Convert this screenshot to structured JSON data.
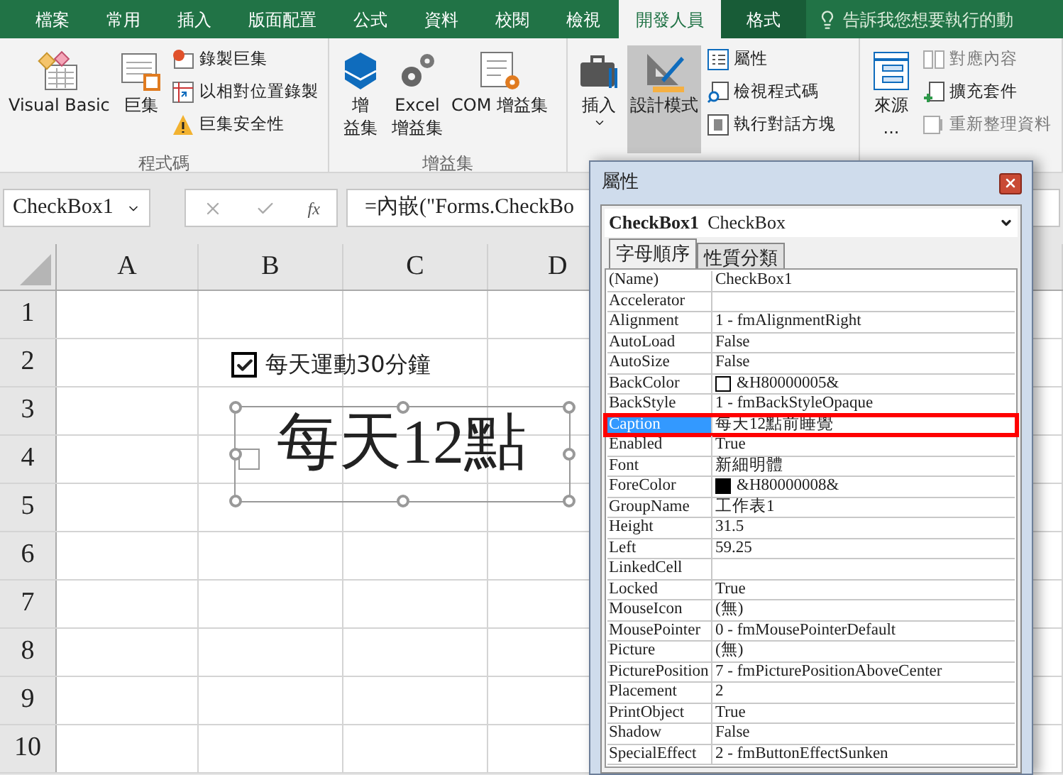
{
  "ribbon_tabs": [
    {
      "label": "檔案",
      "selected": false,
      "kind": "normal"
    },
    {
      "label": "常用",
      "selected": false,
      "kind": "normal"
    },
    {
      "label": "插入",
      "selected": false,
      "kind": "normal"
    },
    {
      "label": "版面配置",
      "selected": false,
      "kind": "normal"
    },
    {
      "label": "公式",
      "selected": false,
      "kind": "normal"
    },
    {
      "label": "資料",
      "selected": false,
      "kind": "normal"
    },
    {
      "label": "校閱",
      "selected": false,
      "kind": "normal"
    },
    {
      "label": "檢視",
      "selected": false,
      "kind": "normal"
    },
    {
      "label": "開發人員",
      "selected": true,
      "kind": "normal"
    },
    {
      "label": "格式",
      "selected": false,
      "kind": "contextual"
    }
  ],
  "tell_me": "告訴我您想要執行的動",
  "ribbon_groups": [
    {
      "label": "程式碼",
      "large_buttons": [
        {
          "lines": [
            "Visual Basic"
          ],
          "selected": false,
          "dropdown": false
        },
        {
          "lines": [
            "巨集"
          ],
          "selected": false,
          "dropdown": false
        }
      ],
      "small_buttons": [
        {
          "label": "錄製巨集",
          "disabled": false
        },
        {
          "label": "以相對位置錄製",
          "disabled": false
        },
        {
          "label": "巨集安全性",
          "disabled": false
        }
      ]
    },
    {
      "label": "增益集",
      "large_buttons": [
        {
          "lines": [
            "增",
            "益集"
          ],
          "selected": false,
          "dropdown": false
        },
        {
          "lines": [
            "Excel",
            "增益集"
          ],
          "selected": false,
          "dropdown": false
        },
        {
          "lines": [
            "COM 增益集"
          ],
          "selected": false,
          "dropdown": false
        }
      ]
    },
    {
      "large_buttons": [
        {
          "lines": [
            "插入"
          ],
          "selected": false,
          "dropdown": true
        },
        {
          "lines": [
            "設計模式"
          ],
          "selected": true,
          "dropdown": false
        }
      ],
      "small_buttons": [
        {
          "label": "屬性",
          "disabled": false
        },
        {
          "label": "檢視程式碼",
          "disabled": false
        },
        {
          "label": "執行對話方塊",
          "disabled": false
        }
      ]
    },
    {
      "large_buttons": [
        {
          "lines": [
            "來源",
            "..."
          ],
          "selected": false,
          "dropdown": false
        }
      ],
      "small_buttons": [
        {
          "label": "對應內容",
          "disabled": true
        },
        {
          "label": "擴充套件",
          "disabled": false
        },
        {
          "label": "重新整理資料",
          "disabled": true
        }
      ]
    }
  ],
  "name_box": "CheckBox1",
  "function_button": "fx",
  "formula": "=內嵌(\"Forms.CheckBo",
  "sheet": {
    "columns": [
      "A",
      "B",
      "C",
      "D"
    ],
    "rows": [
      "1",
      "2",
      "3",
      "4",
      "5",
      "6",
      "7",
      "8",
      "9",
      "10"
    ],
    "checkboxes": [
      {
        "caption": "每天運動30分鐘",
        "checked": true,
        "selected": false
      },
      {
        "caption": "每天12點",
        "checked": false,
        "selected": true
      }
    ]
  },
  "properties": {
    "title": "屬性",
    "object_name": "CheckBox1",
    "object_type": "CheckBox",
    "tabs": [
      {
        "label": "字母順序",
        "selected": true
      },
      {
        "label": "性質分類",
        "selected": false
      }
    ],
    "rows": [
      {
        "name": "(Name)",
        "value": "CheckBox1",
        "selected": false,
        "highlighted": false
      },
      {
        "name": "Accelerator",
        "value": "",
        "selected": false,
        "highlighted": false
      },
      {
        "name": "Alignment",
        "value": "1 - fmAlignmentRight",
        "selected": false,
        "highlighted": false
      },
      {
        "name": "AutoLoad",
        "value": "False",
        "selected": false,
        "highlighted": false
      },
      {
        "name": "AutoSize",
        "value": "False",
        "selected": false,
        "highlighted": false
      },
      {
        "name": "BackColor",
        "value": "&H80000005&",
        "color": "#ffffff",
        "selected": false,
        "highlighted": false
      },
      {
        "name": "BackStyle",
        "value": "1 - fmBackStyleOpaque",
        "selected": false,
        "highlighted": false
      },
      {
        "name": "Caption",
        "value": "每天12點前睡覺",
        "selected": true,
        "highlighted": true
      },
      {
        "name": "Enabled",
        "value": "True",
        "selected": false,
        "highlighted": false
      },
      {
        "name": "Font",
        "value": "新細明體",
        "selected": false,
        "highlighted": false
      },
      {
        "name": "ForeColor",
        "value": "&H80000008&",
        "color": "#000000",
        "selected": false,
        "highlighted": false
      },
      {
        "name": "GroupName",
        "value": "工作表1",
        "selected": false,
        "highlighted": false
      },
      {
        "name": "Height",
        "value": "31.5",
        "selected": false,
        "highlighted": false
      },
      {
        "name": "Left",
        "value": "59.25",
        "selected": false,
        "highlighted": false
      },
      {
        "name": "LinkedCell",
        "value": "",
        "selected": false,
        "highlighted": false
      },
      {
        "name": "Locked",
        "value": "True",
        "selected": false,
        "highlighted": false
      },
      {
        "name": "MouseIcon",
        "value": "(無)",
        "selected": false,
        "highlighted": false
      },
      {
        "name": "MousePointer",
        "value": "0 - fmMousePointerDefault",
        "selected": false,
        "highlighted": false
      },
      {
        "name": "Picture",
        "value": "(無)",
        "selected": false,
        "highlighted": false
      },
      {
        "name": "PicturePosition",
        "value": "7 - fmPicturePositionAboveCenter",
        "selected": false,
        "highlighted": false
      },
      {
        "name": "Placement",
        "value": "2",
        "selected": false,
        "highlighted": false
      },
      {
        "name": "PrintObject",
        "value": "True",
        "selected": false,
        "highlighted": false
      },
      {
        "name": "Shadow",
        "value": "False",
        "selected": false,
        "highlighted": false
      },
      {
        "name": "SpecialEffect",
        "value": "2 - fmButtonEffectSunken",
        "selected": false,
        "highlighted": false
      }
    ]
  }
}
